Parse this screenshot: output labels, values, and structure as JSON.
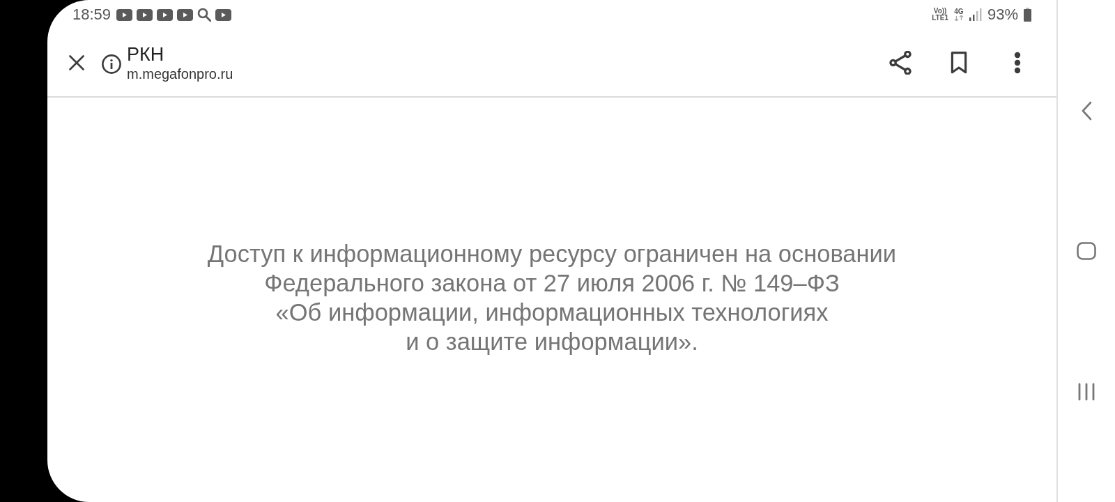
{
  "status_bar": {
    "time": "18:59",
    "notification_icons": [
      {
        "kind": "video"
      },
      {
        "kind": "video"
      },
      {
        "kind": "video"
      },
      {
        "kind": "video"
      },
      {
        "kind": "search"
      },
      {
        "kind": "video"
      }
    ],
    "network": {
      "volte": "Vo))",
      "lte": "LTE1",
      "type": "4G"
    },
    "battery": "93%"
  },
  "toolbar": {
    "title": "РКН",
    "url": "m.megafonpro.ru"
  },
  "message": {
    "lines": [
      "Доступ к информационному ресурсу ограничен на основании",
      "Федерального закона от 27 июля 2006 г. № 149–ФЗ",
      "«Об информации, информационных технологиях",
      "и о защите информации»."
    ]
  }
}
